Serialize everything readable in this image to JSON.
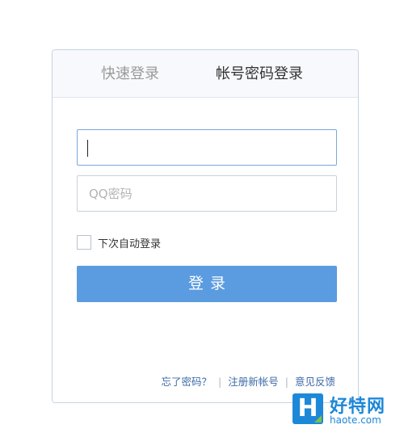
{
  "tabs": {
    "quick_login": "快速登录",
    "password_login": "帐号密码登录"
  },
  "form": {
    "account_value": "",
    "password_placeholder": "QQ密码",
    "remember_label": "下次自动登录",
    "remember_checked": false,
    "submit_label": "登录"
  },
  "footer": {
    "forgot_password": "忘了密码？",
    "register": "注册新帐号",
    "feedback": "意见反馈",
    "separator": "|"
  },
  "watermark": {
    "logo_letter": "H",
    "site_name": "好特网",
    "url": "haote.com"
  },
  "colors": {
    "accent": "#5b9be0",
    "link": "#3d6aa8",
    "panel_border": "#c6d4e6",
    "watermark_blue": "#1e88d8",
    "watermark_green": "#7dc242"
  }
}
